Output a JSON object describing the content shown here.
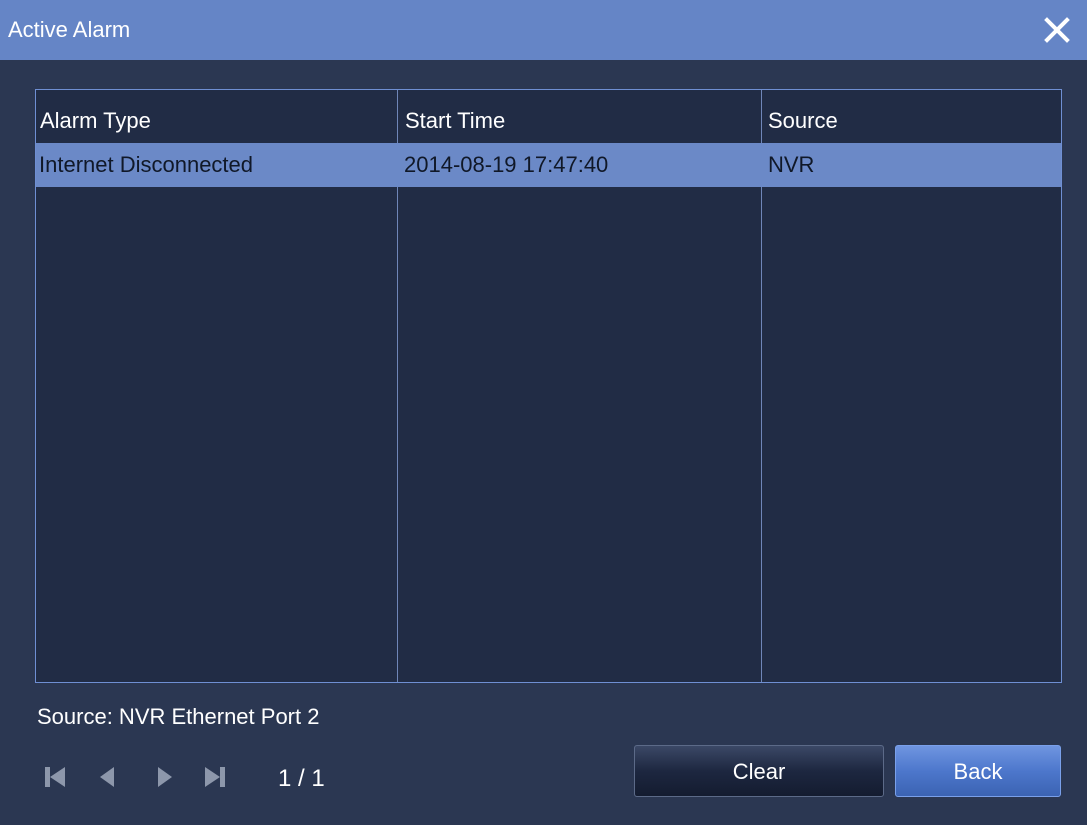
{
  "window": {
    "title": "Active Alarm"
  },
  "table": {
    "columns": [
      "Alarm Type",
      "Start Time",
      "Source"
    ],
    "rows": [
      {
        "alarm_type": "Internet Disconnected",
        "start_time": "2014-08-19  17:47:40",
        "source": "NVR",
        "selected": true
      }
    ]
  },
  "details": {
    "source_text": "Source:  NVR  Ethernet  Port  2"
  },
  "pager": {
    "page_text": "1  /  1",
    "current_page": 1,
    "total_pages": 1
  },
  "buttons": {
    "clear_label": "Clear",
    "back_label": "Back"
  },
  "icons": {
    "close": "close-icon",
    "first": "first-page-icon",
    "prev": "previous-page-icon",
    "next": "next-page-icon",
    "last": "last-page-icon"
  },
  "colors": {
    "titlebar": "#6585c6",
    "background": "#2b3752",
    "table_background": "#212c45",
    "selected_row": "#6b89c7",
    "accent_button": "#4d77cc"
  }
}
